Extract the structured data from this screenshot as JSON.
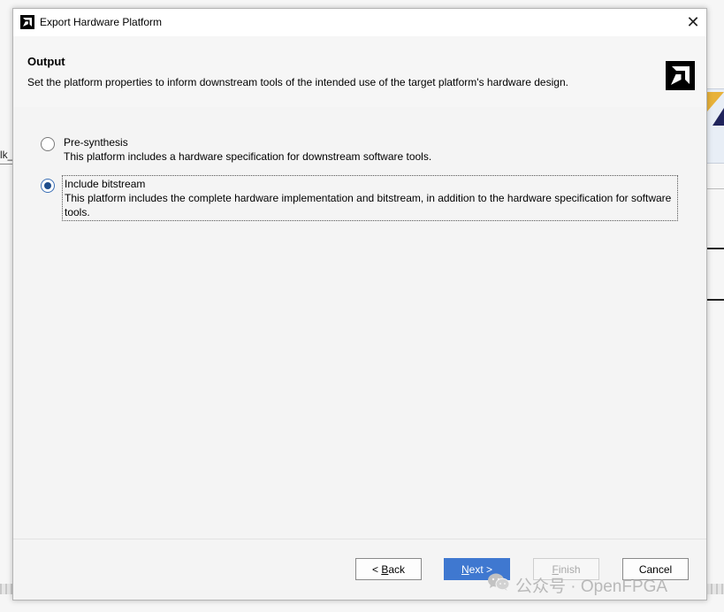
{
  "background": {
    "left_fragment_text": "lk_"
  },
  "dialog": {
    "title": "Export Hardware Platform",
    "close_glyph": "✕",
    "header": {
      "title": "Output",
      "description": "Set the platform properties to inform downstream tools of the intended use of the target platform's hardware design."
    },
    "options": [
      {
        "title": "Pre-synthesis",
        "description": "This platform includes a hardware specification for downstream software tools.",
        "selected": false
      },
      {
        "title": "Include bitstream",
        "description": "This platform includes the complete hardware implementation and bitstream, in addition to the hardware specification for software tools.",
        "selected": true
      }
    ],
    "buttons": {
      "back": {
        "prefix": "< ",
        "mnemonic": "B",
        "rest": "ack"
      },
      "next": {
        "mnemonic": "N",
        "rest": "ext >"
      },
      "finish": {
        "mnemonic": "F",
        "rest": "inish",
        "enabled": false
      },
      "cancel": {
        "label": "Cancel"
      }
    }
  },
  "watermark": {
    "text": "公众号 · OpenFPGA"
  },
  "colors": {
    "primary_button": "#3f78d0",
    "radio_selected": "#1f4e8c",
    "dialog_bg": "#f4f4f4"
  },
  "icons": {
    "app_icon": "amd-logo-icon",
    "header_logo": "amd-logo-icon",
    "close": "close-icon",
    "watermark": "wechat-icon"
  }
}
